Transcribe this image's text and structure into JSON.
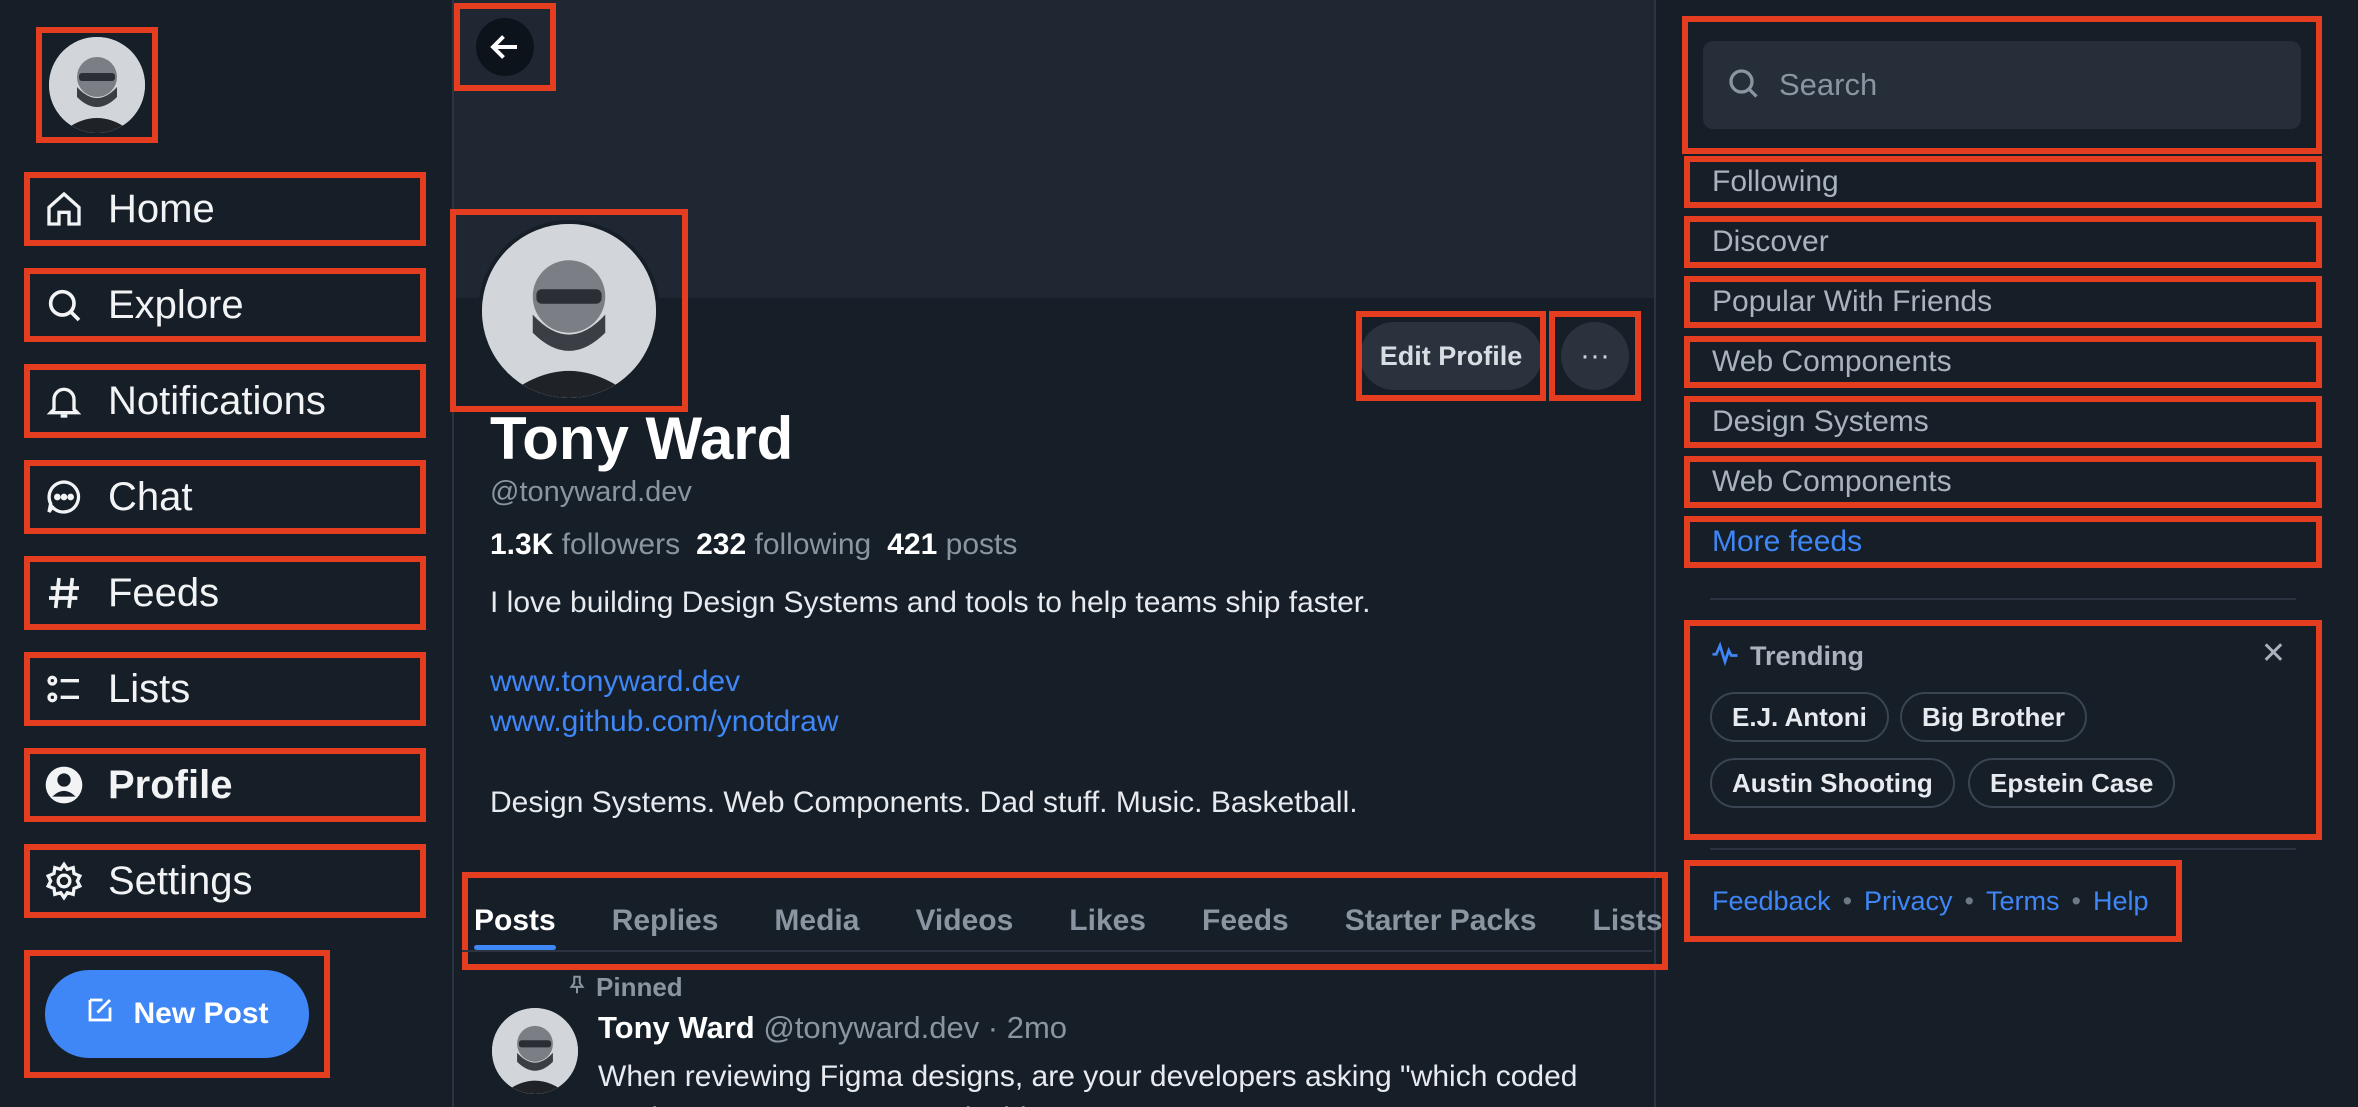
{
  "sidebar": {
    "nav": [
      {
        "label": "Home",
        "icon": "home-icon"
      },
      {
        "label": "Explore",
        "icon": "search-icon"
      },
      {
        "label": "Notifications",
        "icon": "bell-icon"
      },
      {
        "label": "Chat",
        "icon": "chat-icon"
      },
      {
        "label": "Feeds",
        "icon": "hash-icon"
      },
      {
        "label": "Lists",
        "icon": "list-icon"
      },
      {
        "label": "Profile",
        "icon": "person-icon"
      },
      {
        "label": "Settings",
        "icon": "gear-icon"
      }
    ],
    "new_post_label": "New Post"
  },
  "profile": {
    "name": "Tony Ward",
    "handle": "@tonyward.dev",
    "followers_count": "1.3K",
    "followers_label": "followers",
    "following_count": "232",
    "following_label": "following",
    "posts_count": "421",
    "posts_label": "posts",
    "bio_line1": "I love building Design Systems and tools to help teams ship faster.",
    "link1": "www.tonyward.dev",
    "link2": "www.github.com/ynotdraw",
    "bio_line2": "Design Systems. Web Components. Dad stuff. Music. Basketball.",
    "edit_label": "Edit Profile",
    "more_label": "···"
  },
  "tabs": [
    "Posts",
    "Replies",
    "Media",
    "Videos",
    "Likes",
    "Feeds",
    "Starter Packs",
    "Lists"
  ],
  "post": {
    "pinned_label": "Pinned",
    "author": "Tony Ward",
    "meta": "@tonyward.dev · 2mo",
    "text": "When reviewing Figma designs, are your developers asking \"which coded Design System component is this?\""
  },
  "right": {
    "search_placeholder": "Search",
    "feeds": [
      "Following",
      "Discover",
      "Popular With Friends",
      "Web Components",
      "Design Systems",
      "Web Components"
    ],
    "more_feeds": "More feeds",
    "trending_title": "Trending",
    "trending_close": "✕",
    "trends": [
      "E.J. Antoni",
      "Big Brother",
      "Austin Shooting",
      "Epstein Case"
    ],
    "footer_links": [
      "Feedback",
      "Privacy",
      "Terms",
      "Help"
    ],
    "footer_sep": "•"
  },
  "colors": {
    "background": "#161e27",
    "accent": "#3f86f7",
    "highlight": "#e53d1f"
  }
}
